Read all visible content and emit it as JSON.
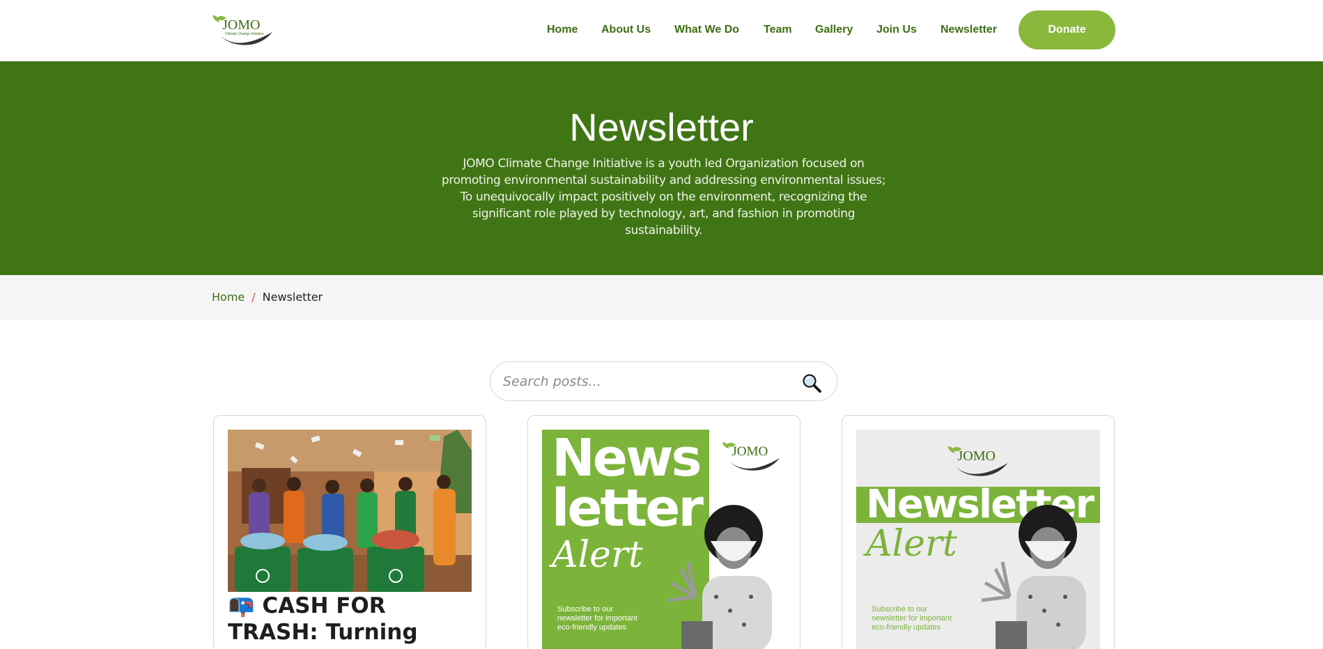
{
  "header": {
    "nav": [
      "Home",
      "About Us",
      "What We Do",
      "Team",
      "Gallery",
      "Join Us",
      "Newsletter"
    ],
    "donate_label": "Donate"
  },
  "hero": {
    "title": "Newsletter",
    "description": "JOMO Climate Change Initiative is a youth led Organization focused on promoting environmental sustainability and addressing environmental issues; To unequivocally impact positively on the environment, recognizing the significant role played by technology, art, and fashion in promoting sustainability."
  },
  "breadcrumb": {
    "home": "Home",
    "separator": "/",
    "current": "Newsletter"
  },
  "search": {
    "placeholder": "Search posts..."
  },
  "posts": [
    {
      "title": "📭 CASH FOR TRASH: Turning"
    },
    {
      "headline_1": "News",
      "headline_2": "letter",
      "headline_3": "Alert",
      "subscribe": "Subscribe to our newsletter for important eco-friendly updates"
    },
    {
      "headline_1": "Newsletter",
      "headline_2": "Alert",
      "subscribe": "Subscribe to our newsletter for important eco-friendly updates"
    }
  ],
  "colors": {
    "brand_green": "#407516",
    "accent_green": "#8ab83d",
    "nav_text": "#3d6e14"
  }
}
